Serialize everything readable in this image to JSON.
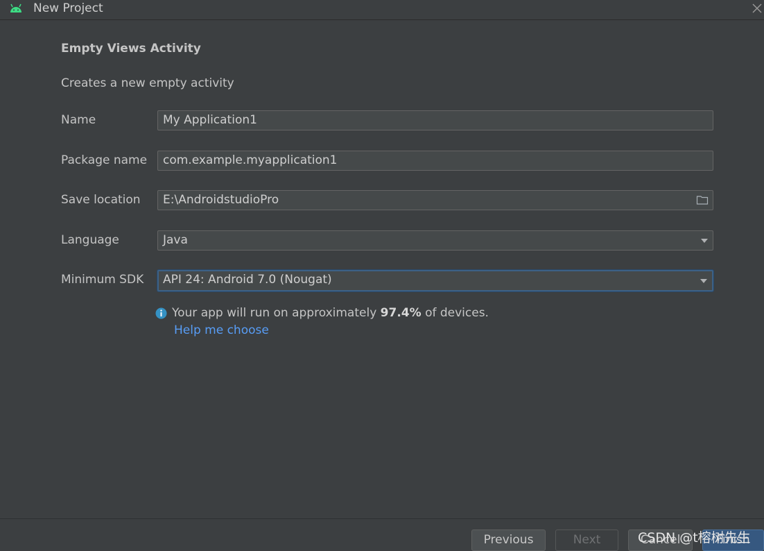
{
  "window": {
    "title": "New Project"
  },
  "form": {
    "heading": "Empty Views Activity",
    "description": "Creates a new empty activity",
    "name": {
      "label": "Name",
      "value": "My Application1"
    },
    "package": {
      "label": "Package name",
      "value": "com.example.myapplication1"
    },
    "location": {
      "label": "Save location",
      "value": "E:\\AndroidstudioPro"
    },
    "language": {
      "label": "Language",
      "value": "Java"
    },
    "min_sdk": {
      "label": "Minimum SDK",
      "value": "API 24: Android 7.0 (Nougat)"
    }
  },
  "info": {
    "text_before": "Your app will run on approximately",
    "percent": "97.4%",
    "text_after": "of devices.",
    "help_link": "Help me choose"
  },
  "buttons": {
    "previous": "Previous",
    "next": "Next",
    "cancel": "Cancel",
    "finish": "Finish"
  },
  "watermark": "CSDN @t榕树先生",
  "colors": {
    "background": "#3c3f41",
    "link": "#589df6",
    "focus": "#3d6185",
    "android_green": "#3ddc84"
  }
}
